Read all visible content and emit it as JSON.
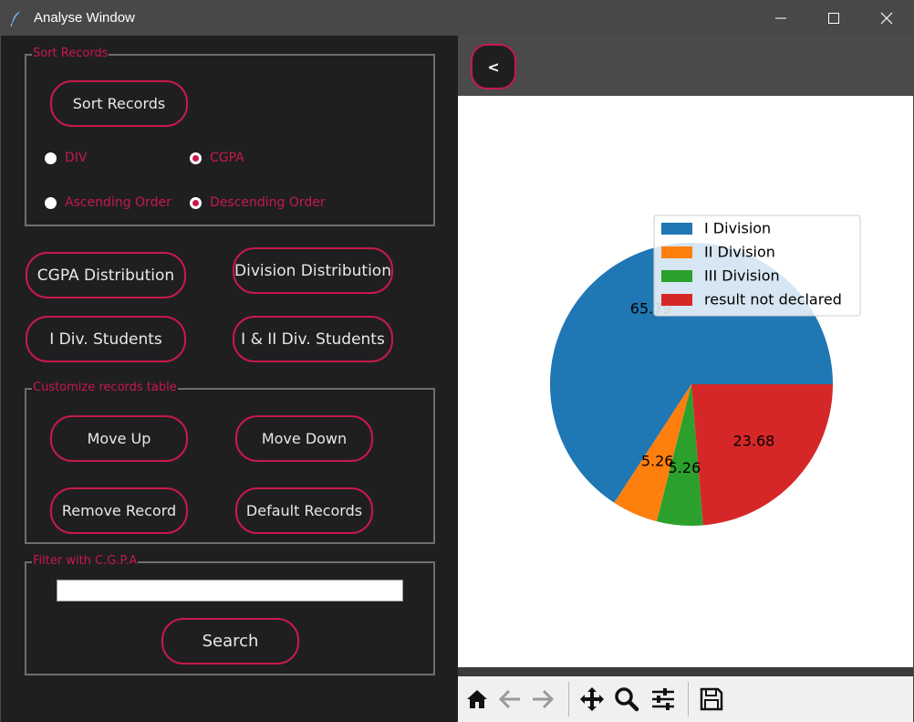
{
  "window": {
    "title": "Analyse Window",
    "controls": [
      "minimize",
      "maximize",
      "close"
    ]
  },
  "sort_group": {
    "legend": "Sort Records",
    "sort_button": "Sort Records",
    "radio_key": {
      "div": "DIV",
      "cgpa": "CGPA",
      "selected": "CGPA"
    },
    "radio_order": {
      "asc": "Ascending Order",
      "desc": "Descending Order",
      "selected": "Descending Order"
    }
  },
  "actions": {
    "cgpa_distribution": "CGPA Distribution",
    "division_distribution": "Division Distribution",
    "first_div_students": "I Div. Students",
    "first_second_div_students": "I & II Div. Students"
  },
  "customize_group": {
    "legend": "Customize records table",
    "move_up": "Move Up",
    "move_down": "Move Down",
    "remove_record": "Remove Record",
    "default_records": "Default Records"
  },
  "filter_group": {
    "legend": "Filter with C.G.P.A",
    "input_value": "",
    "search_button": "Search"
  },
  "plot": {
    "back_button": "<",
    "toolbar": [
      "home-icon",
      "back-arrow-icon",
      "forward-arrow-icon",
      "pan-icon",
      "zoom-icon",
      "configure-subplots-icon",
      "save-icon"
    ]
  },
  "colors": {
    "accent": "#c8194a",
    "panel_bg": "#1f1f21",
    "series": [
      "#1f77b4",
      "#ff7f0e",
      "#2ca02c",
      "#d62728"
    ]
  },
  "chart_data": {
    "type": "pie",
    "labels": [
      "I Division",
      "II Division",
      "III Division",
      "result not declared"
    ],
    "values": [
      65.79,
      5.26,
      5.26,
      23.68
    ],
    "data_labels": [
      "65.79",
      "5.26",
      "5.26",
      "23.68"
    ],
    "colors": [
      "#1f77b4",
      "#ff7f0e",
      "#2ca02c",
      "#d62728"
    ],
    "legend_position": "upper-right",
    "title": ""
  }
}
